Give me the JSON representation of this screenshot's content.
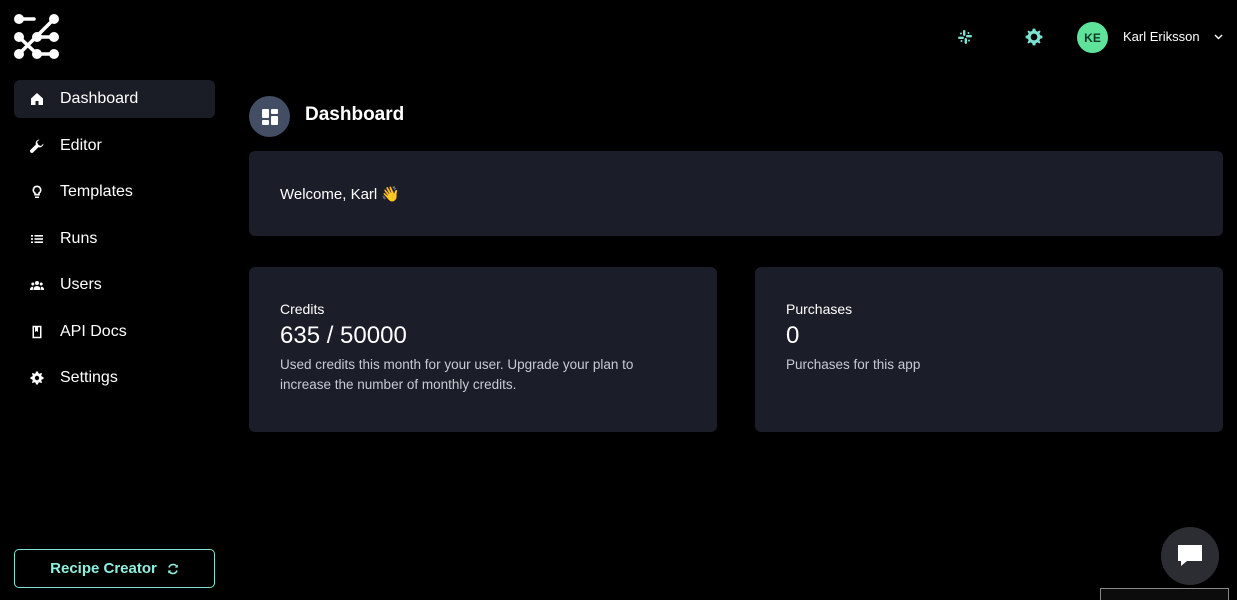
{
  "sidebar": {
    "items": [
      {
        "label": "Dashboard",
        "icon": "home-icon",
        "active": true
      },
      {
        "label": "Editor",
        "icon": "wrench-icon"
      },
      {
        "label": "Templates",
        "icon": "lightbulb-icon"
      },
      {
        "label": "Runs",
        "icon": "list-icon"
      },
      {
        "label": "Users",
        "icon": "users-icon"
      },
      {
        "label": "API Docs",
        "icon": "book-icon"
      },
      {
        "label": "Settings",
        "icon": "gear-icon"
      }
    ],
    "recipe_button": "Recipe Creator"
  },
  "header": {
    "avatar_initials": "KE",
    "user_name": "Karl Eriksson"
  },
  "main": {
    "title": "Dashboard",
    "welcome": "Welcome, Karl 👋",
    "credits": {
      "label": "Credits",
      "value": "635 / 50000",
      "description": "Used credits this month for your user. Upgrade your plan to increase the number of monthly credits."
    },
    "purchases": {
      "label": "Purchases",
      "value": "0",
      "description": "Purchases for this app"
    }
  },
  "colors": {
    "background": "#000000",
    "card": "#1b1d28",
    "accent_teal": "#7ce3d4",
    "avatar_green": "#5fe39b"
  }
}
